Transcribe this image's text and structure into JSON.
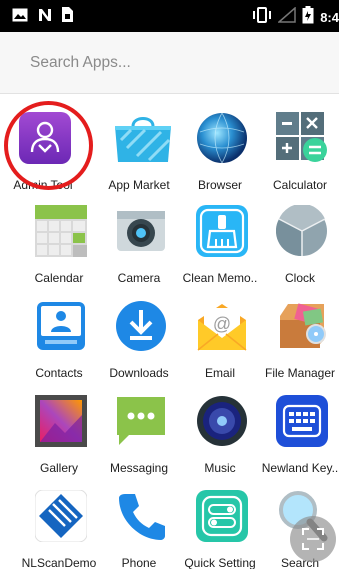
{
  "status_bar": {
    "time": "8:4",
    "left_icons": [
      "image-icon",
      "notification-n-icon",
      "sim-doc-icon"
    ],
    "right_icons": [
      "vibrate-icon",
      "signal-icon",
      "battery-icon"
    ]
  },
  "search": {
    "placeholder": "Search Apps..."
  },
  "apps": [
    {
      "label": "Admin Tool",
      "icon": "admin-tool-icon"
    },
    {
      "label": "App Market",
      "icon": "app-market-icon"
    },
    {
      "label": "Browser",
      "icon": "browser-icon"
    },
    {
      "label": "Calculator",
      "icon": "calculator-icon"
    },
    {
      "label": "Calendar",
      "icon": "calendar-icon"
    },
    {
      "label": "Camera",
      "icon": "camera-icon"
    },
    {
      "label": "Clean Memo..",
      "icon": "clean-memory-icon"
    },
    {
      "label": "Clock",
      "icon": "clock-icon"
    },
    {
      "label": "Contacts",
      "icon": "contacts-icon"
    },
    {
      "label": "Downloads",
      "icon": "downloads-icon"
    },
    {
      "label": "Email",
      "icon": "email-icon"
    },
    {
      "label": "File Manager",
      "icon": "file-manager-icon"
    },
    {
      "label": "Gallery",
      "icon": "gallery-icon"
    },
    {
      "label": "Messaging",
      "icon": "messaging-icon"
    },
    {
      "label": "Music",
      "icon": "music-icon"
    },
    {
      "label": "Newland Key..",
      "icon": "newland-keyboard-icon"
    },
    {
      "label": "NLScanDemo",
      "icon": "nlscandemo-icon"
    },
    {
      "label": "Phone",
      "icon": "phone-icon"
    },
    {
      "label": "Quick Setting",
      "icon": "quick-setting-icon"
    },
    {
      "label": "Search",
      "icon": "search-icon"
    }
  ],
  "colors": {
    "highlight": "#e41d1d",
    "status_bar": "#000000",
    "search_bg": "#f7f7f7"
  }
}
